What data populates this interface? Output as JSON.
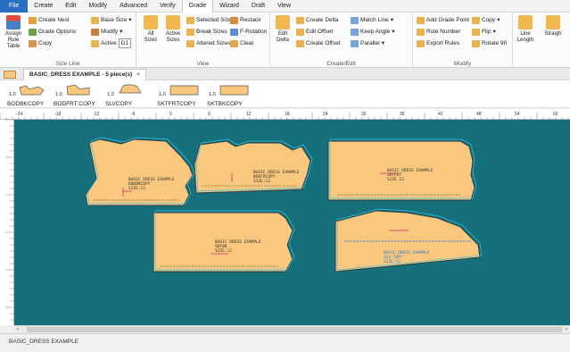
{
  "menu": [
    "File",
    "Create",
    "Edit",
    "Modify",
    "Advanced",
    "Verify",
    "Grade",
    "Wizard",
    "Draft",
    "View"
  ],
  "ribbon": {
    "size_line": {
      "label": "Size Line",
      "assign": "Assign Rule Table",
      "create_nest": "Create Nest",
      "grade_options": "Grade Options",
      "copy": "Copy",
      "base_size": "Base Size",
      "modify": "Modify",
      "active": "Active",
      "active_value": "D1"
    },
    "view": {
      "label": "View",
      "all_sizes": "All Sizes",
      "active_sizes": "Active Sizes",
      "selected_sizes": "Selected Sizes",
      "break_sizes": "Break Sizes",
      "altered_sizes": "Altered Sizes",
      "restack": "Restack",
      "f_rotation": "F-Rotation",
      "clear": "Clear"
    },
    "create_edit": {
      "label": "Create/Edit",
      "edit_delta": "Edit Delta",
      "create_delta": "Create Delta",
      "edit_offset": "Edit Offset",
      "create_offset": "Create Offset",
      "match_line": "Match Line",
      "keep_angle": "Keep Angle",
      "parallel": "Parallel"
    },
    "modify": {
      "label": "Modify",
      "add_grade_point": "Add Grade Point",
      "rule_number": "Rule Number",
      "export_rules": "Export Rules",
      "copy": "Copy",
      "flip": "Flip",
      "rotate_90": "Rotate 90"
    },
    "line": {
      "line_length": "Line Length",
      "straight": "Straigh"
    }
  },
  "document_tab": "BASIC_DRESS EXAMPLE - 5 piece(s)",
  "tab_close": "×",
  "pieces": [
    {
      "count": "1.0",
      "name": "BODBKCOPY"
    },
    {
      "count": "1.0",
      "name": "BODFRT COPY"
    },
    {
      "count": "1.0",
      "name": "SLVCOPY"
    },
    {
      "count": "1.0",
      "name": "SKTFRTCOPY"
    },
    {
      "count": "1.0",
      "name": "SKTBKCOPY"
    }
  ],
  "ruler_labels": [
    "-24",
    "-18",
    "-12",
    "-6",
    "0",
    "6",
    "12",
    "18",
    "24",
    "30",
    "36",
    "42",
    "48",
    "54",
    "60"
  ],
  "canvas_pieces": [
    {
      "lines": [
        "BASIC DRESS EXAMPLE",
        "BODBKCOPY",
        "SIZE:12"
      ]
    },
    {
      "lines": [
        "BASIC DRESS EXAMPLE",
        "BODFRCOPY",
        "SIZE:12"
      ]
    },
    {
      "lines": [
        "BASIC DRESS EXAMPLE",
        "SKTFRT",
        "SIZE 12"
      ]
    },
    {
      "lines": [
        "BASIC DRESS EXAMPLE",
        "SKTBK",
        "SIZE:12"
      ]
    },
    {
      "lines": [
        "BASIC DRESS EXAMPLE",
        "SLV COPY",
        "SIZE:12"
      ]
    }
  ],
  "status_text": "BASIC_DRESS EXAMPLE",
  "colors": {
    "canvas": "#16707c",
    "piece_fill": "#f9c77e",
    "grade_lines": "#33c6e6"
  }
}
